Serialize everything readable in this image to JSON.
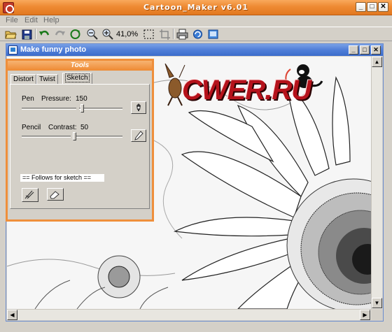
{
  "window": {
    "title": "Cartoon_Maker v6.01"
  },
  "menu": [
    {
      "label": "File"
    },
    {
      "label": "Edit"
    },
    {
      "label": "Help"
    }
  ],
  "toolbar": {
    "zoom": "41,0%"
  },
  "inner_window": {
    "title": "Make funny photo"
  },
  "watermark": {
    "text": "CWER.RU"
  },
  "tools": {
    "title": "Tools",
    "tabs": [
      {
        "label": "Distort"
      },
      {
        "label": "Twist"
      },
      {
        "label": "Sketch"
      }
    ],
    "active_tab": "Sketch",
    "pen": {
      "label": "Pen",
      "pressure_label": "Pressure:",
      "pressure_value": "150"
    },
    "pencil": {
      "label": "Pencil",
      "contrast_label": "Contrast:",
      "contrast_value": "50"
    },
    "follows_label": "== Follows for sketch =="
  },
  "colors": {
    "title_orange": "#ee8a33",
    "inner_title_blue": "#3b6ccb",
    "logo_red": "#b5121b"
  }
}
